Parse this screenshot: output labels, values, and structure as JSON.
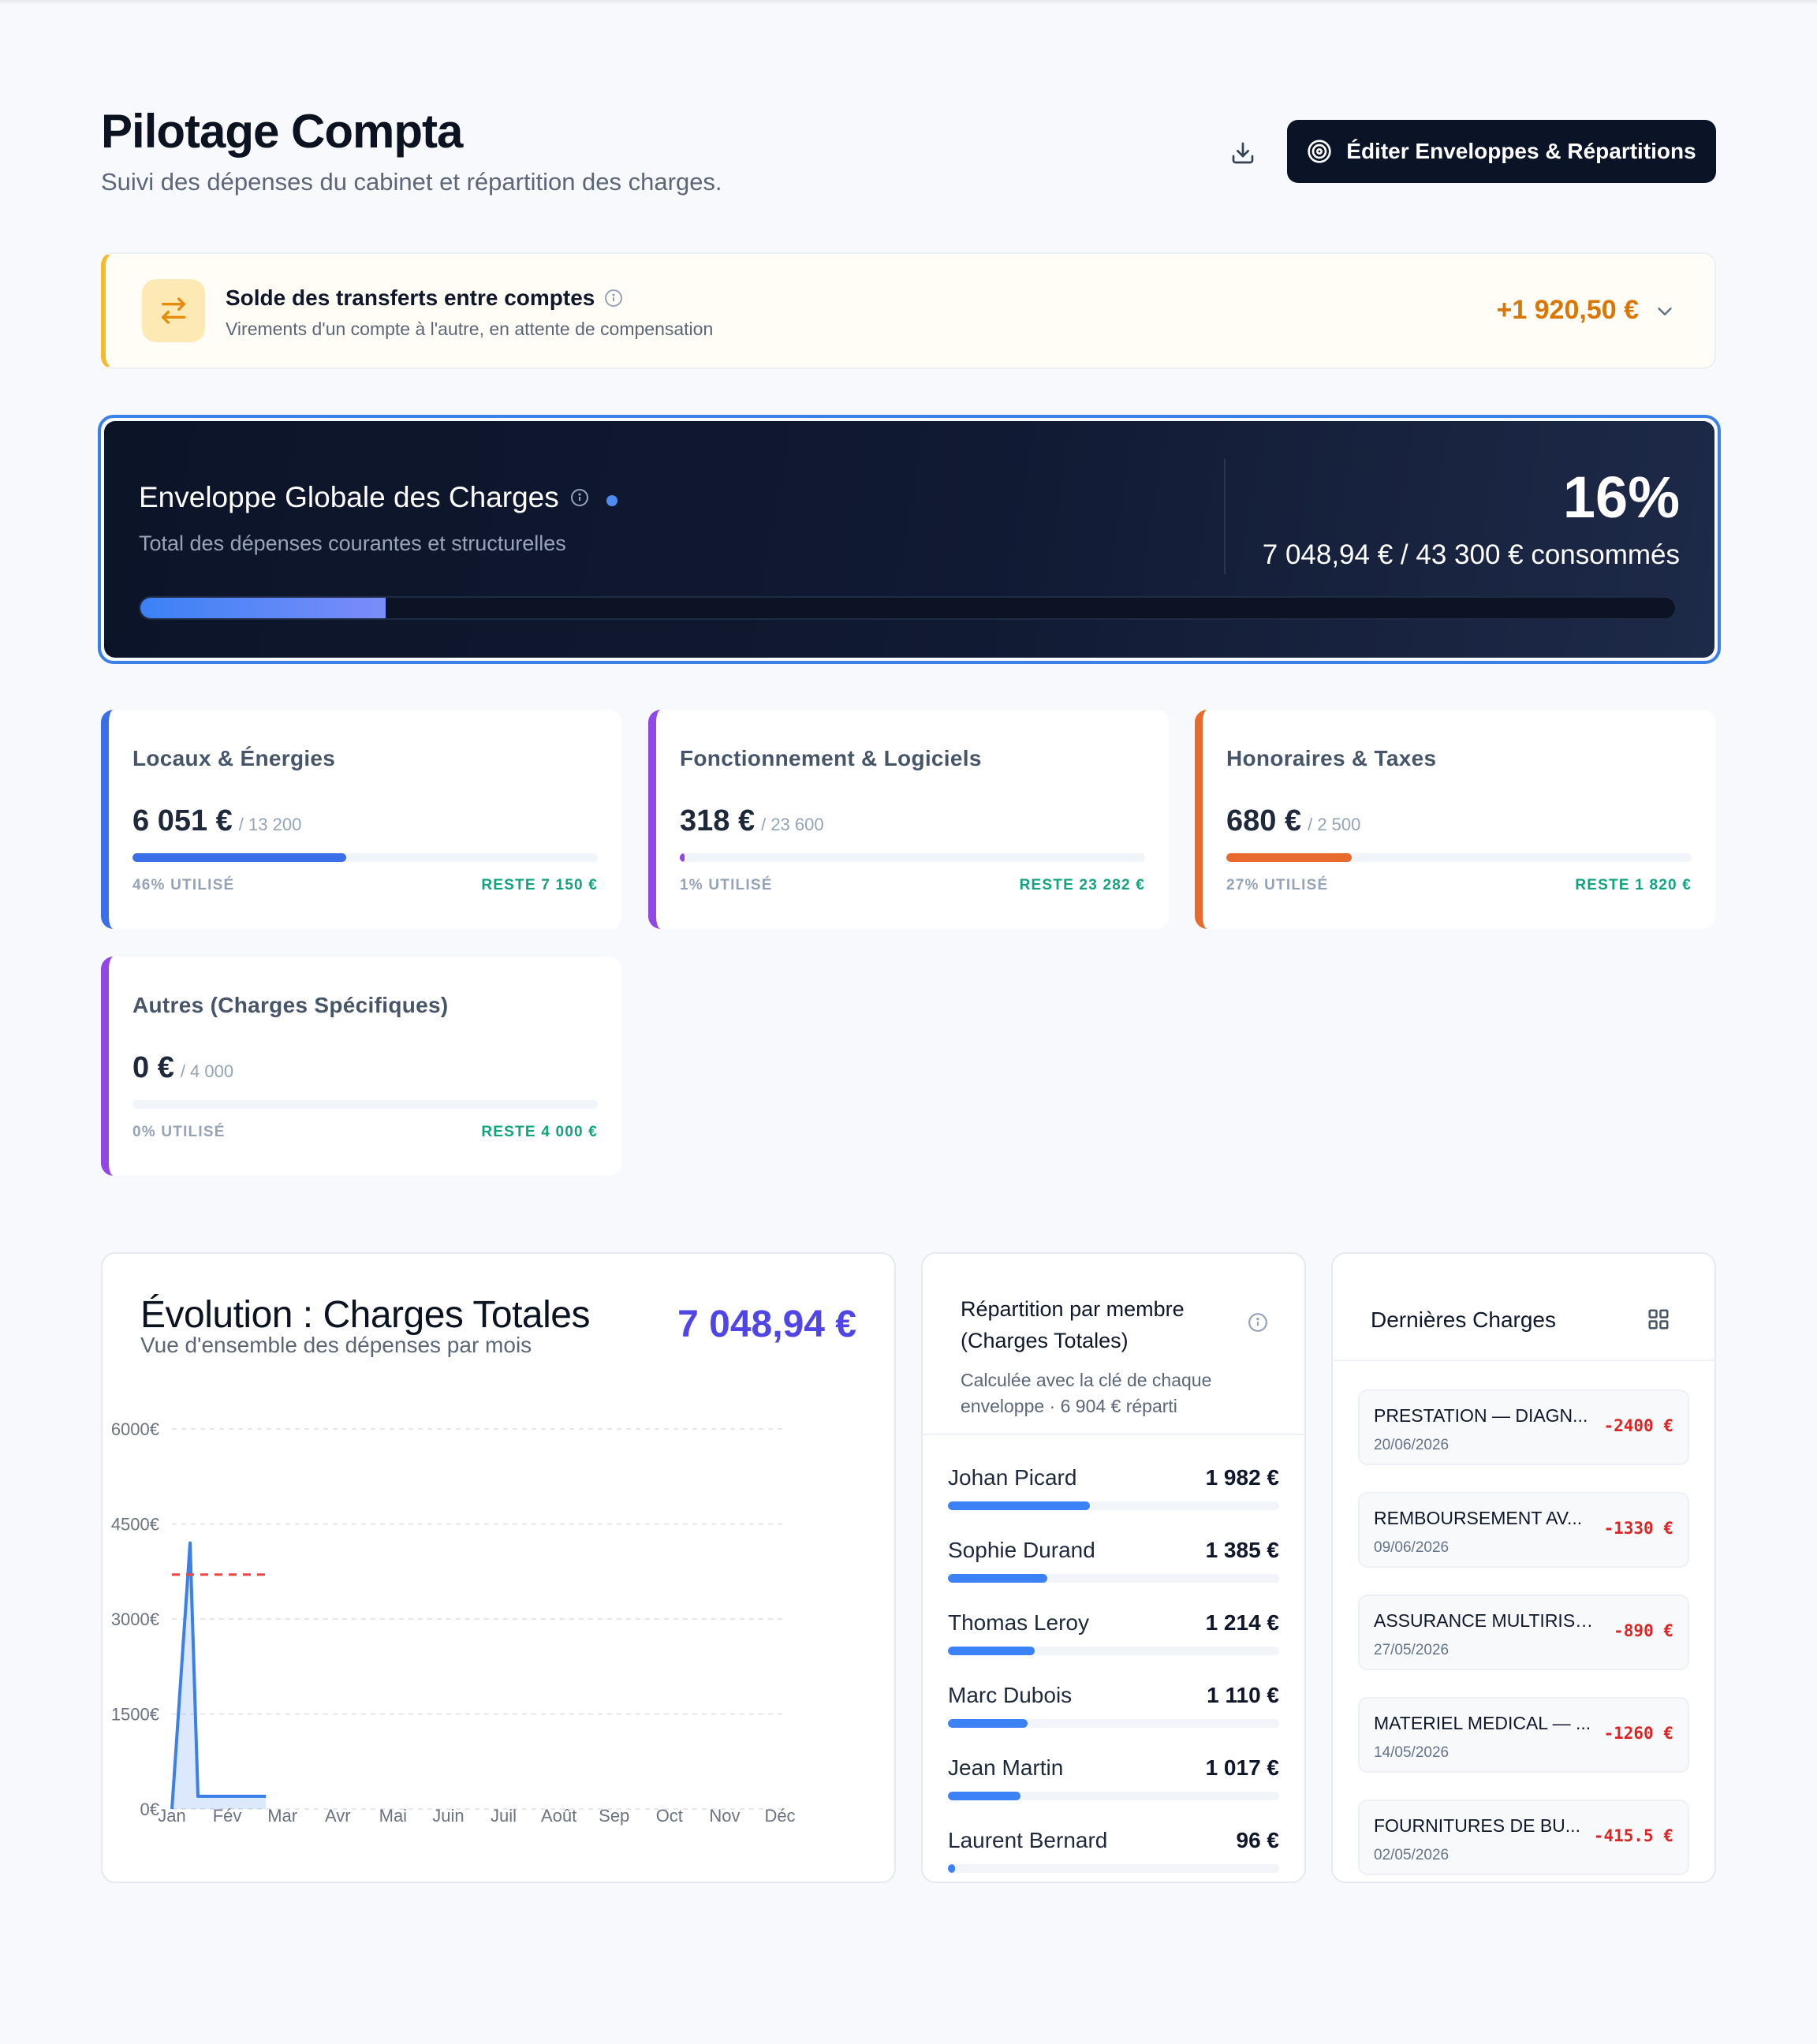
{
  "header": {
    "title": "Pilotage Compta",
    "subtitle": "Suivi des dépenses du cabinet et répartition des charges.",
    "edit_label": "Éditer Enveloppes & Répartitions"
  },
  "transfer": {
    "title": "Solde des transferts entre comptes",
    "description": "Virements d'un compte à l'autre, en attente de compensation",
    "amount": "+1 920,50 €"
  },
  "global_envelope": {
    "title": "Enveloppe Globale des Charges",
    "description": "Total des dépenses courantes et structurelles",
    "percent_label": "16%",
    "percent": 16,
    "consumed": "7 048,94 € / 43 300 € consommés"
  },
  "categories": [
    {
      "title": "Locaux & Énergies",
      "amount": "6 051 €",
      "budget": "/ 13 200",
      "used_label": "46% UTILISÉ",
      "used": 46,
      "rest": "RESTE 7 150 €",
      "color": "#3b6fe8"
    },
    {
      "title": "Fonctionnement & Logiciels",
      "amount": "318 €",
      "budget": "/ 23 600",
      "used_label": "1% UTILISÉ",
      "used": 1,
      "rest": "RESTE 23 282 €",
      "color": "#9147e6"
    },
    {
      "title": "Honoraires & Taxes",
      "amount": "680 €",
      "budget": "/ 2 500",
      "used_label": "27% UTILISÉ",
      "used": 27,
      "rest": "RESTE 1 820 €",
      "color": "#e86a2c"
    },
    {
      "title": "Autres (Charges Spécifiques)",
      "amount": "0 €",
      "budget": "/ 4 000",
      "used_label": "0% UTILISÉ",
      "used": 0,
      "rest": "RESTE 4 000 €",
      "color": "#9147e6"
    }
  ],
  "evolution": {
    "title": "Évolution : Charges Totales",
    "subtitle": "Vue d'ensemble des dépenses par mois",
    "total": "7 048,94 €"
  },
  "chart_data": {
    "type": "area",
    "categories": [
      "Jan",
      "Fév",
      "Mar",
      "Avr",
      "Mai",
      "Juin",
      "Juil",
      "Août",
      "Sep",
      "Oct",
      "Nov",
      "Déc"
    ],
    "series": [
      {
        "values": [
          0,
          4200,
          200,
          200
        ]
      }
    ],
    "y_ticks": [
      "6000€",
      "4500€",
      "3000€",
      "1500€",
      "0€"
    ],
    "ylim": [
      0,
      6000
    ],
    "reference_line": 3700,
    "grid": true,
    "colors": {
      "line": "#3b7fe8",
      "reference": "#ef4444"
    }
  },
  "repartition": {
    "title": "Répartition par membre (Charges Totales)",
    "description": "Calculée avec la clé de chaque enveloppe · 6 904 € réparti",
    "members": [
      {
        "name": "Johan Picard",
        "value": "1 982 €",
        "amount": 1982
      },
      {
        "name": "Sophie Durand",
        "value": "1 385 €",
        "amount": 1385
      },
      {
        "name": "Thomas Leroy",
        "value": "1 214 €",
        "amount": 1214
      },
      {
        "name": "Marc Dubois",
        "value": "1 110 €",
        "amount": 1110
      },
      {
        "name": "Jean Martin",
        "value": "1 017 €",
        "amount": 1017
      },
      {
        "name": "Laurent Bernard",
        "value": "96 €",
        "amount": 96
      }
    ]
  },
  "last_charges": {
    "title": "Dernières Charges",
    "items": [
      {
        "name": "PRESTATION — DIAGN...",
        "date": "20/06/2026",
        "amount": "-2400 €"
      },
      {
        "name": "REMBOURSEMENT AV...",
        "date": "09/06/2026",
        "amount": "-1330 €"
      },
      {
        "name": "ASSURANCE MULTIRISQ...",
        "date": "27/05/2026",
        "amount": "-890 €"
      },
      {
        "name": "MATERIEL MEDICAL — ...",
        "date": "14/05/2026",
        "amount": "-1260 €"
      },
      {
        "name": "FOURNITURES DE BU...",
        "date": "02/05/2026",
        "amount": "-415.5 €"
      }
    ]
  }
}
